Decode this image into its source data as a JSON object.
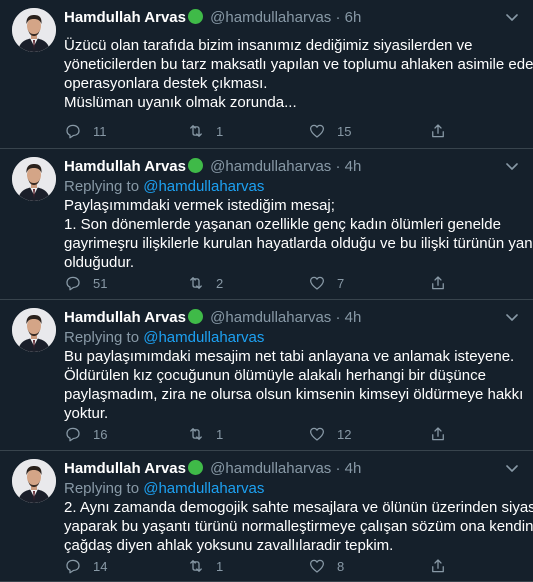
{
  "colors": {
    "background": "#15202b",
    "text": "#ffffff",
    "muted": "#8899a6",
    "accent": "#1da1f2",
    "badge": "#3fba48",
    "divider": "#38444d"
  },
  "icons": {
    "reply": "reply-icon",
    "retweet": "retweet-icon",
    "like": "heart-icon",
    "share": "share-icon",
    "more": "chevron-down-icon",
    "badge": "green-circle-icon"
  },
  "tweets": [
    {
      "name": "Hamdullah Arvas",
      "handle": "@hamdullaharvas",
      "separator": "·",
      "time": "6h",
      "replying_label": "",
      "replying_to": "",
      "lines": [
        "Üzücü olan tarafıda bizim insanımız dediğimiz siyasilerden ve",
        "yöneticilerden bu tarz maksatlı yapılan ve toplumu ahlaken asimile eden",
        "operasyonlara destek çıkması.",
        "Müslüman uyanık olmak zorunda..."
      ],
      "replies": "11",
      "retweets": "1",
      "likes": "15"
    },
    {
      "name": "Hamdullah Arvas",
      "handle": "@hamdullaharvas",
      "separator": "·",
      "time": "4h",
      "replying_label": "Replying to",
      "replying_to": "@hamdullaharvas",
      "lines": [
        "Paylaşımımdaki vermek istediğim mesaj;",
        "1. Son dönemlerde yaşanan ozellikle genç kadın ölümleri genelde",
        "gayrimeşru ilişkilerle kurulan hayatlarda olduğu ve bu ilişki türünün yanlış",
        "olduğudur."
      ],
      "replies": "51",
      "retweets": "2",
      "likes": "7"
    },
    {
      "name": "Hamdullah Arvas",
      "handle": "@hamdullaharvas",
      "separator": "·",
      "time": "4h",
      "replying_label": "Replying to",
      "replying_to": "@hamdullaharvas",
      "lines": [
        "Bu paylaşımımdaki mesajim net tabi anlayana ve anlamak isteyene.",
        "Öldürülen kız çocuğunun ölümüyle alakalı herhangi bir düşünce",
        "paylaşmadım, zira ne olursa olsun kimsenin kimseyi öldürmeye hakkı",
        "yoktur."
      ],
      "replies": "16",
      "retweets": "1",
      "likes": "12"
    },
    {
      "name": "Hamdullah Arvas",
      "handle": "@hamdullaharvas",
      "separator": "·",
      "time": "4h",
      "replying_label": "Replying to",
      "replying_to": "@hamdullaharvas",
      "lines": [
        "2. Aynı zamanda demogojik sahte mesajlara ve ölünün üzerinden siyaset",
        "yaparak bu yaşantı türünü normalleştirmeye çalışan sözüm ona kendine",
        "çağdaş diyen ahlak yoksunu zavallılaradir tepkim."
      ],
      "replies": "14",
      "retweets": "1",
      "likes": "8"
    }
  ]
}
